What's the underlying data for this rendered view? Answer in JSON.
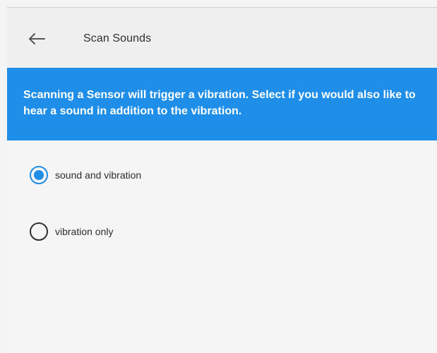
{
  "header": {
    "back_icon": "arrow-left-icon",
    "title": "Scan Sounds"
  },
  "banner": {
    "text": "Scanning a Sensor will trigger a vibration. Select if you would also like to hear a sound in addition to the vibration."
  },
  "options": [
    {
      "label": "sound and vibration",
      "selected": true
    },
    {
      "label": "vibration only",
      "selected": false
    }
  ],
  "colors": {
    "accent": "#1f8ee8",
    "background": "#f5f5f5",
    "app_bar": "#efefef",
    "text": "#303030"
  }
}
